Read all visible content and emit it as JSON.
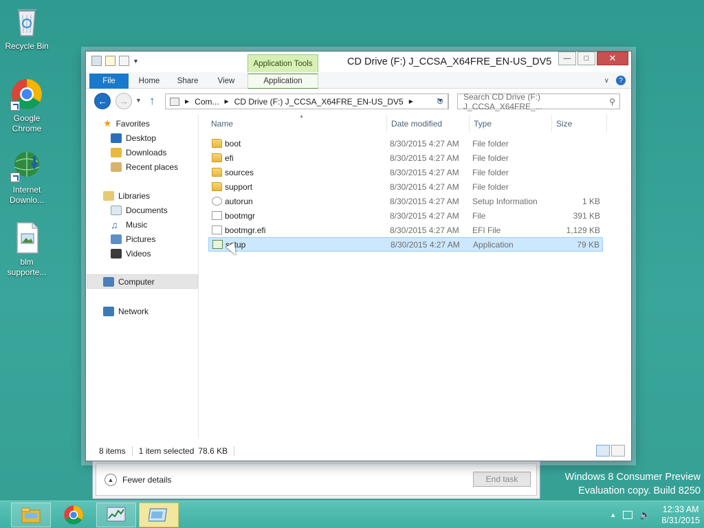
{
  "desktop": {
    "icons": [
      {
        "label": "Recycle Bin"
      },
      {
        "label": "Google Chrome"
      },
      {
        "label": "Internet Downlo..."
      },
      {
        "label": "blm supporte..."
      }
    ],
    "watermark_line1": "Windows 8 Consumer Preview",
    "watermark_line2": "Evaluation copy. Build 8250"
  },
  "task_manager": {
    "fewer_details": "Fewer details",
    "end_task": "End task"
  },
  "window": {
    "title": "CD Drive (F:) J_CCSA_X64FRE_EN-US_DV5",
    "context_tab_group": "Application Tools",
    "ribbon_tabs": [
      {
        "label": "File"
      },
      {
        "label": "Home"
      },
      {
        "label": "Share"
      },
      {
        "label": "View"
      },
      {
        "label": "Application"
      }
    ],
    "address": {
      "seg1": "Com...",
      "seg2": "CD Drive (F:) J_CCSA_X64FRE_EN-US_DV5"
    },
    "search_placeholder": "Search CD Drive (F:) J_CCSA_X64FRE_...",
    "nav": {
      "favorites": "Favorites",
      "desktop": "Desktop",
      "downloads": "Downloads",
      "recent": "Recent places",
      "libraries": "Libraries",
      "documents": "Documents",
      "music": "Music",
      "pictures": "Pictures",
      "videos": "Videos",
      "computer": "Computer",
      "network": "Network"
    },
    "columns": {
      "name": "Name",
      "date": "Date modified",
      "type": "Type",
      "size": "Size"
    },
    "files": [
      {
        "name": "boot",
        "date": "8/30/2015 4:27 AM",
        "type": "File folder",
        "size": "",
        "icon": "folder-icon"
      },
      {
        "name": "efi",
        "date": "8/30/2015 4:27 AM",
        "type": "File folder",
        "size": "",
        "icon": "folder-icon"
      },
      {
        "name": "sources",
        "date": "8/30/2015 4:27 AM",
        "type": "File folder",
        "size": "",
        "icon": "folder-icon"
      },
      {
        "name": "support",
        "date": "8/30/2015 4:27 AM",
        "type": "File folder",
        "size": "",
        "icon": "folder-icon"
      },
      {
        "name": "autorun",
        "date": "8/30/2015 4:27 AM",
        "type": "Setup Information",
        "size": "1 KB",
        "icon": "setup-info-icon"
      },
      {
        "name": "bootmgr",
        "date": "8/30/2015 4:27 AM",
        "type": "File",
        "size": "391 KB",
        "icon": "file-icon"
      },
      {
        "name": "bootmgr.efi",
        "date": "8/30/2015 4:27 AM",
        "type": "EFI File",
        "size": "1,129 KB",
        "icon": "file-icon"
      },
      {
        "name": "setup",
        "date": "8/30/2015 4:27 AM",
        "type": "Application",
        "size": "79 KB",
        "icon": "application-icon",
        "selected": true
      }
    ],
    "status": {
      "items": "8 items",
      "selected": "1 item selected",
      "selected_size": "78.6 KB"
    }
  },
  "taskbar": {
    "time": "12:33 AM",
    "date": "8/31/2015"
  },
  "colors": {
    "desktop": "#3a9e94",
    "accent": "#1979ca",
    "selection": "#cce8ff",
    "app_tools": "#d8f0b8"
  }
}
